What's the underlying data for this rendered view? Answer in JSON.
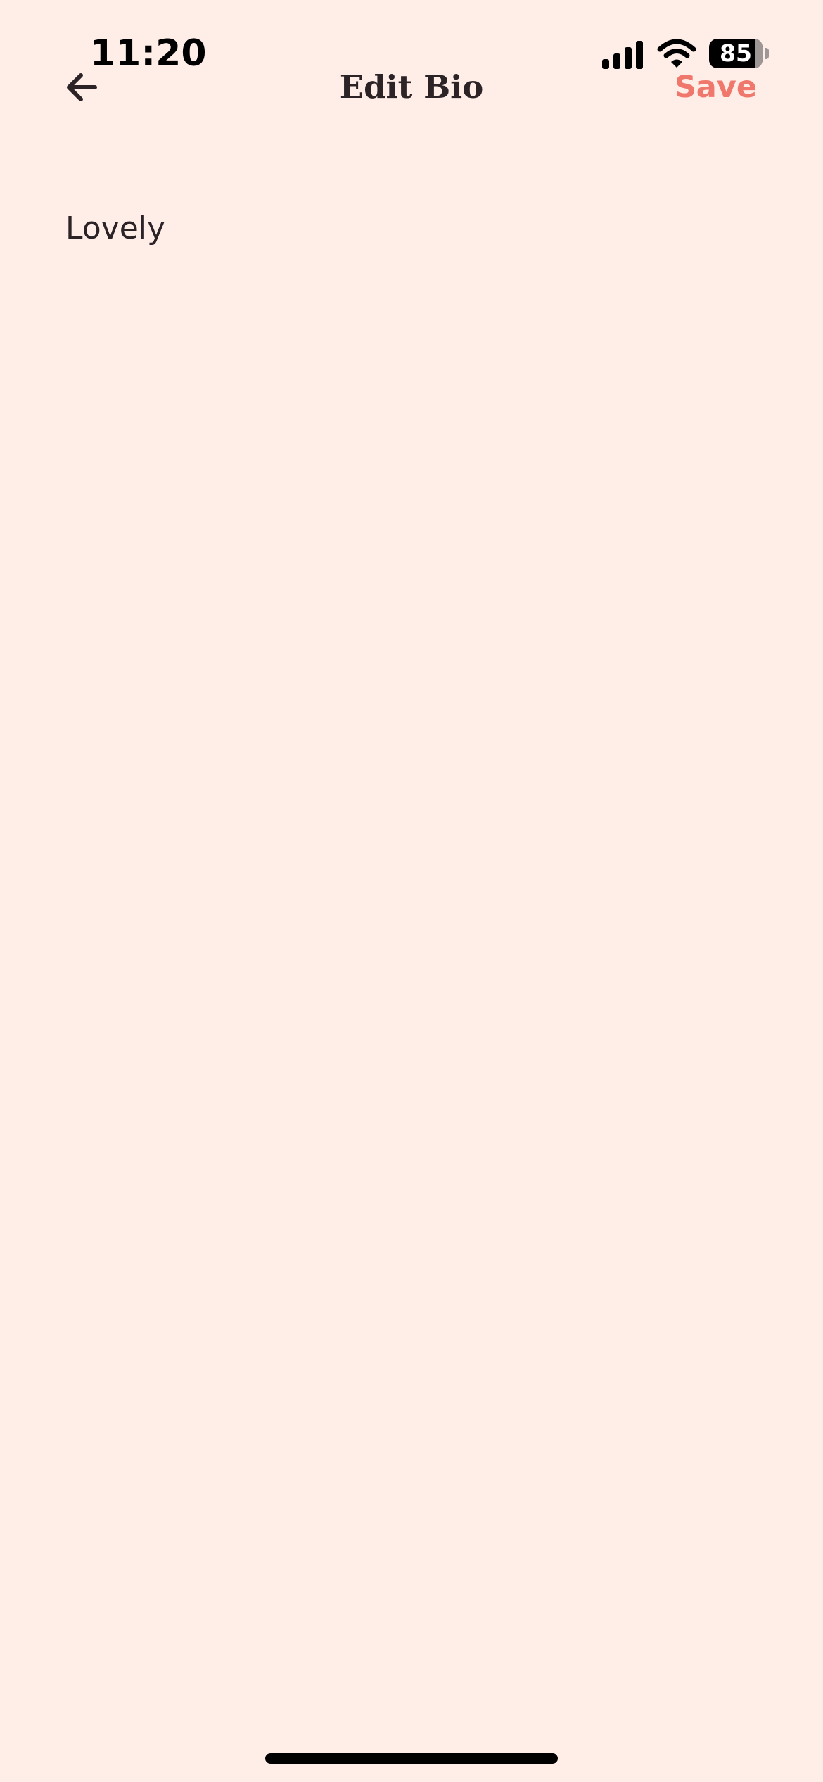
{
  "status_bar": {
    "time": "11:20",
    "signal_icon": "cellular-signal-icon",
    "wifi_icon": "wifi-icon",
    "battery_icon": "battery-icon",
    "battery_level": "85",
    "battery_fraction": 0.85
  },
  "nav": {
    "back_icon": "arrow-left-icon",
    "title": "Edit Bio",
    "save_label": "Save",
    "save_color": "#F0776B"
  },
  "bio": {
    "value": "Lovely"
  },
  "colors": {
    "background": "#FFEDE8",
    "text": "#2B2326",
    "accent": "#F0776B"
  }
}
